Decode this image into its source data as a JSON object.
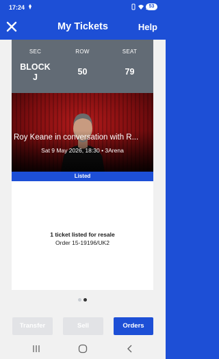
{
  "status_bar": {
    "time": "17:24",
    "battery": "53"
  },
  "app_bar": {
    "title": "My Tickets",
    "help": "Help"
  },
  "ticket": {
    "seat": {
      "sec_label": "SEC",
      "sec_value_line1": "BLOCK",
      "sec_value_line2": "J",
      "row_label": "ROW",
      "row_value": "50",
      "seat_label": "SEAT",
      "seat_value": "79"
    },
    "event_title": "Roy Keane in conversation with  R...",
    "event_subtitle": "Sat 9 May 2026, 18:30 • 3Arena",
    "status_banner": "Listed",
    "resale_text": "1 ticket listed for resale",
    "order_text": "Order 15-19196/UK2"
  },
  "pagination": {
    "active_index": 1,
    "count": 2
  },
  "actions": {
    "transfer": "Transfer",
    "sell": "Sell",
    "orders": "Orders"
  },
  "colors": {
    "brand": "#1d4fd6",
    "seat_block": "#626b75",
    "disabled": "#e2e3e6",
    "banner_red": "#b21b1b"
  }
}
